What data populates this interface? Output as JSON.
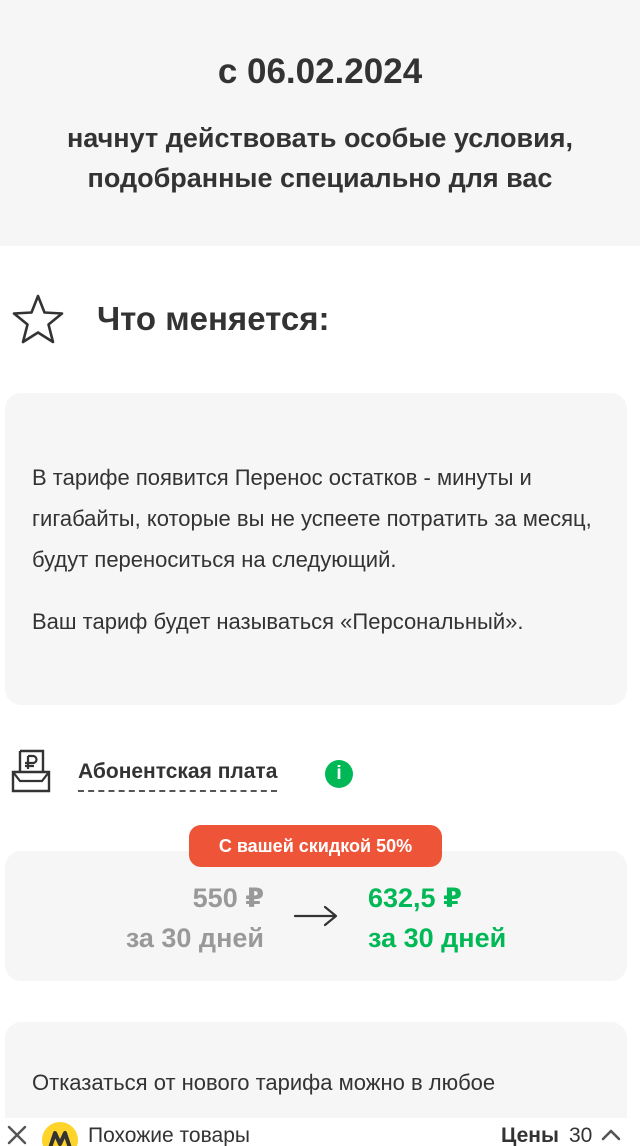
{
  "hero": {
    "date": "с 06.02.2024",
    "subtitle_line1": "начнут действовать особые условия,",
    "subtitle_line2": "подобранные специально для вас"
  },
  "changes": {
    "icon": "star-icon",
    "title": "Что меняется:",
    "paragraph1": "В тарифе появится Перенос остатков - минуты и гигабайты, которые вы не успеете потратить за месяц, будут переноситься на следующий.",
    "paragraph2": "Ваш тариф будет называться «Персональный»."
  },
  "fee": {
    "icon": "receipt-ruble-icon",
    "label": "Абонентская плата",
    "info_icon_glyph": "i",
    "discount_badge": "С вашей скидкой 50%",
    "old_price": "550 ₽",
    "old_period": "за 30 дней",
    "new_price": "632,5 ₽",
    "new_period": "за 30 дней"
  },
  "refuse": {
    "text": "Отказаться от нового тарифа можно в любое"
  },
  "bottom_bar": {
    "similar_label": "Похожие товары",
    "prices_label": "Цены",
    "prices_count": "30"
  },
  "colors": {
    "accent_green": "#00b956",
    "badge_red": "#ee5538",
    "card_bg": "#f6f6f6",
    "text": "#333333",
    "muted": "#999999",
    "ym_yellow": "#fed42b"
  }
}
